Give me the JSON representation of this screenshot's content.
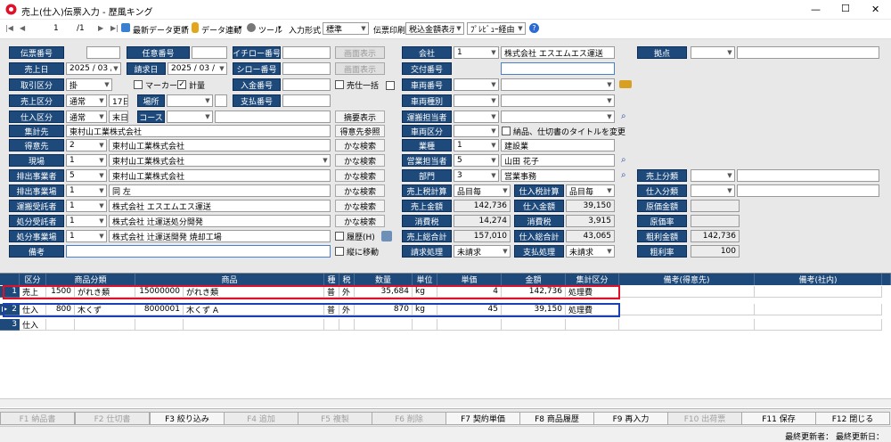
{
  "window": {
    "title": "売上(仕入)伝票入力 - 歴風キング",
    "min": "—",
    "max": "☐",
    "close": "✕"
  },
  "toolbar": {
    "nav_first": "|◀",
    "nav_prev": "◀",
    "page_current": "1",
    "page_sep": "/1",
    "nav_next": "▶",
    "nav_last": "▶|",
    "refresh": "最新データ更新",
    "data_link": "データ連動",
    "tool": "ツール",
    "input_form_label": "入力形式",
    "input_form_value": "標準",
    "print_label": "伝票印刷",
    "print_value": "税込金額表示",
    "preview_value": "ﾌﾟﾚﾋﾞｭｰ経由"
  },
  "labels": {
    "denpyo": "伝票番号",
    "ninni": "任意番号",
    "ichiro": "イチロー番号",
    "gamen1": "画面表示",
    "kaisha": "会社",
    "kyoten": "拠点",
    "uriagebi": "売上日",
    "seikyubi": "請求日",
    "shiro": "シロー番号",
    "gamen2": "画面表示",
    "kofu": "交付番号",
    "torihiki": "取引区分",
    "marker": "マーカー",
    "keiryo": "計量",
    "nyukin": "入金番号",
    "uriikkatsu": "売仕一括",
    "sharyo": "車両番号",
    "uriage_kubun": "売上区分",
    "basho": "場所",
    "shiharai": "支払番号",
    "shashu": "車両種別",
    "shiire_kubun": "仕入区分",
    "course": "コース",
    "tekiyo": "摘要表示",
    "unpan": "運搬担当者",
    "shukei": "集計先",
    "tokuisaki_sansho": "得意先参照",
    "sharyo_kubun": "車両区分",
    "title_change": "納品、仕切書のタイトルを変更",
    "tokuisaki": "得意先",
    "kana1": "かな検索",
    "gyoshu": "業種",
    "genba": "現場",
    "kana2": "かな検索",
    "eigyo": "営業担当者",
    "haishutsu": "排出事業者",
    "kana3": "かな検索",
    "bumon": "部門",
    "uriage_bunrui": "売上分類",
    "haishutsujo": "排出事業場",
    "kana4": "かな検索",
    "uriage_zei": "売上税計算",
    "shiire_zei": "仕入税計算",
    "shiire_bunrui": "仕入分類",
    "unpan_jutaku": "運搬受託者",
    "kana5": "かな検索",
    "uriage_kingaku": "売上金額",
    "shiire_kingaku": "仕入金額",
    "genka_kingaku": "原価金額",
    "shobun_jutaku": "処分受託者",
    "kana6": "かな検索",
    "shohizei1": "消費税",
    "shohizei2": "消費税",
    "genka_ritsu": "原価率",
    "shobun_jigyo": "処分事業場",
    "rireki": "履歴(H)",
    "uriage_sogokei": "売上総合計",
    "shiire_sogokei": "仕入総合計",
    "arari_kingaku": "粗利金額",
    "biko": "備考",
    "tate_ido": "縦に移動",
    "seikyu_shori": "請求処理",
    "shiharai_shori": "支払処理",
    "arari_ritsu": "粗利率"
  },
  "values": {
    "kaisha_code": "1",
    "kaisha_name": "株式会社 エスエムエス運送",
    "uriagebi": "2025 / 03 / 21",
    "seikyubi": "2025 / 03 / 21",
    "torihiki": "掛",
    "uriage_kubun": "通常",
    "uriage_day": "17日",
    "shiire_kubun": "通常",
    "shiire_day": "末日",
    "shukei": "東村山工業株式会社",
    "tokuisaki_code": "2",
    "tokuisaki_name": "東村山工業株式会社",
    "gyoshu_code": "1",
    "gyoshu_name": "建設業",
    "genba_code": "1",
    "genba_name": "東村山工業株式会社",
    "eigyo_code": "5",
    "eigyo_name": "山田 花子",
    "haishutsu_code": "5",
    "haishutsu_name": "東村山工業株式会社",
    "bumon_code": "3",
    "bumon_name": "営業事務",
    "haishutsujo_code": "1",
    "haishutsujo_name": "同 左",
    "uriage_zei": "品目毎",
    "shiire_zei": "品目毎",
    "unpan_code": "1",
    "unpan_name": "株式会社 エスエムエス運送",
    "uriage_kingaku": "142,736",
    "shiire_kingaku": "39,150",
    "shobun_code": "1",
    "shobun_name": "株式会社 辻運送処分開発",
    "shohizei1": "14,274",
    "shohizei2": "3,915",
    "shobun_jigyo_code": "1",
    "shobun_jigyo_name": "株式会社 辻運送開発 焼却工場",
    "uriage_sogokei": "157,010",
    "shiire_sogokei": "43,065",
    "arari_kingaku": "142,736",
    "seikyu": "未請求",
    "shiharai": "未請求",
    "arari_ritsu": "100"
  },
  "grid": {
    "headers": [
      "区分",
      "商品分類",
      "商品",
      "種",
      "税",
      "数量",
      "単位",
      "単価",
      "金額",
      "集計区分",
      "備考(得意先)",
      "備考(社内)"
    ],
    "rows": [
      {
        "num": "1",
        "kubun": "売上",
        "bunrui_code": "1500",
        "bunrui_name": "がれき類",
        "shohin_code": "15000000",
        "shohin_name": "がれき類",
        "shu": "普",
        "zei": "外",
        "suryo": "35,684",
        "tani": "kg",
        "tanka": "4",
        "kingaku": "142,736",
        "shukei": "処理費"
      },
      {
        "num": "2",
        "kubun": "仕入",
        "bunrui_code": "800",
        "bunrui_name": "木くず",
        "shohin_code": "8000001",
        "shohin_name": "木くず A",
        "shu": "普",
        "zei": "外",
        "suryo": "870",
        "tani": "kg",
        "tanka": "45",
        "kingaku": "39,150",
        "shukei": "処理費"
      },
      {
        "num": "3",
        "kubun": "仕入",
        "bunrui_code": "",
        "bunrui_name": "",
        "shohin_code": "",
        "shohin_name": "",
        "shu": "",
        "zei": "",
        "suryo": "",
        "tani": "",
        "tanka": "",
        "kingaku": "",
        "shukei": ""
      }
    ]
  },
  "fkeys": [
    "F1 納品書",
    "F2 仕切書",
    "F3 絞り込み",
    "F4 追加",
    "F5 複製",
    "F6 削除",
    "F7 契約単価",
    "F8 商品履歴",
    "F9 再入力",
    "F10 出荷票",
    "F11 保存",
    "F12 閉じる"
  ],
  "status": {
    "text": "最終更新者： 最終更新日："
  },
  "colors": {
    "label_bg": "#1e4a7b",
    "highlight_red": "#e0102a",
    "highlight_blue": "#1b3fb5"
  }
}
